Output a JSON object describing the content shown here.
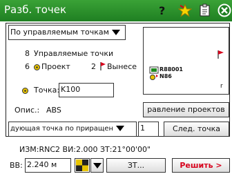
{
  "window": {
    "title": "Разб. точек"
  },
  "toolbar_icons": [
    "help-icon",
    "star-icon",
    "clipboard-icon",
    "close-icon"
  ],
  "mode_select": {
    "value": "По управляемым точкам"
  },
  "counts": {
    "managed": "8",
    "managed_label": "Управляемые точки",
    "project": "6",
    "project_label": "Проект",
    "staked": "2",
    "staked_label": "Вынесе"
  },
  "map_preview": {
    "point_label": "R88001",
    "sub_label": "N86",
    "axis_label": "r"
  },
  "point_field": {
    "label": "Точка:",
    "value": "K100"
  },
  "description": {
    "label": "Опис.:",
    "value": "ABS"
  },
  "direction_button": {
    "label": "равление проектов"
  },
  "next_mode_select": {
    "value": "дующая точка по приращен"
  },
  "increment_field": {
    "value": "1"
  },
  "next_point_button": {
    "label": "След. точка"
  },
  "status": {
    "text": "ИЗМ:RNC2  ВИ:2.000  ЗТ:21°00'00\""
  },
  "bb_field": {
    "label": "ВВ:",
    "value": "2.240 м"
  },
  "zt_button": {
    "label": "ЗТ..."
  },
  "solve_button": {
    "label": "Решить >"
  },
  "colors": {
    "titlebar": "#2f952d",
    "accent_red": "#d7001c"
  }
}
